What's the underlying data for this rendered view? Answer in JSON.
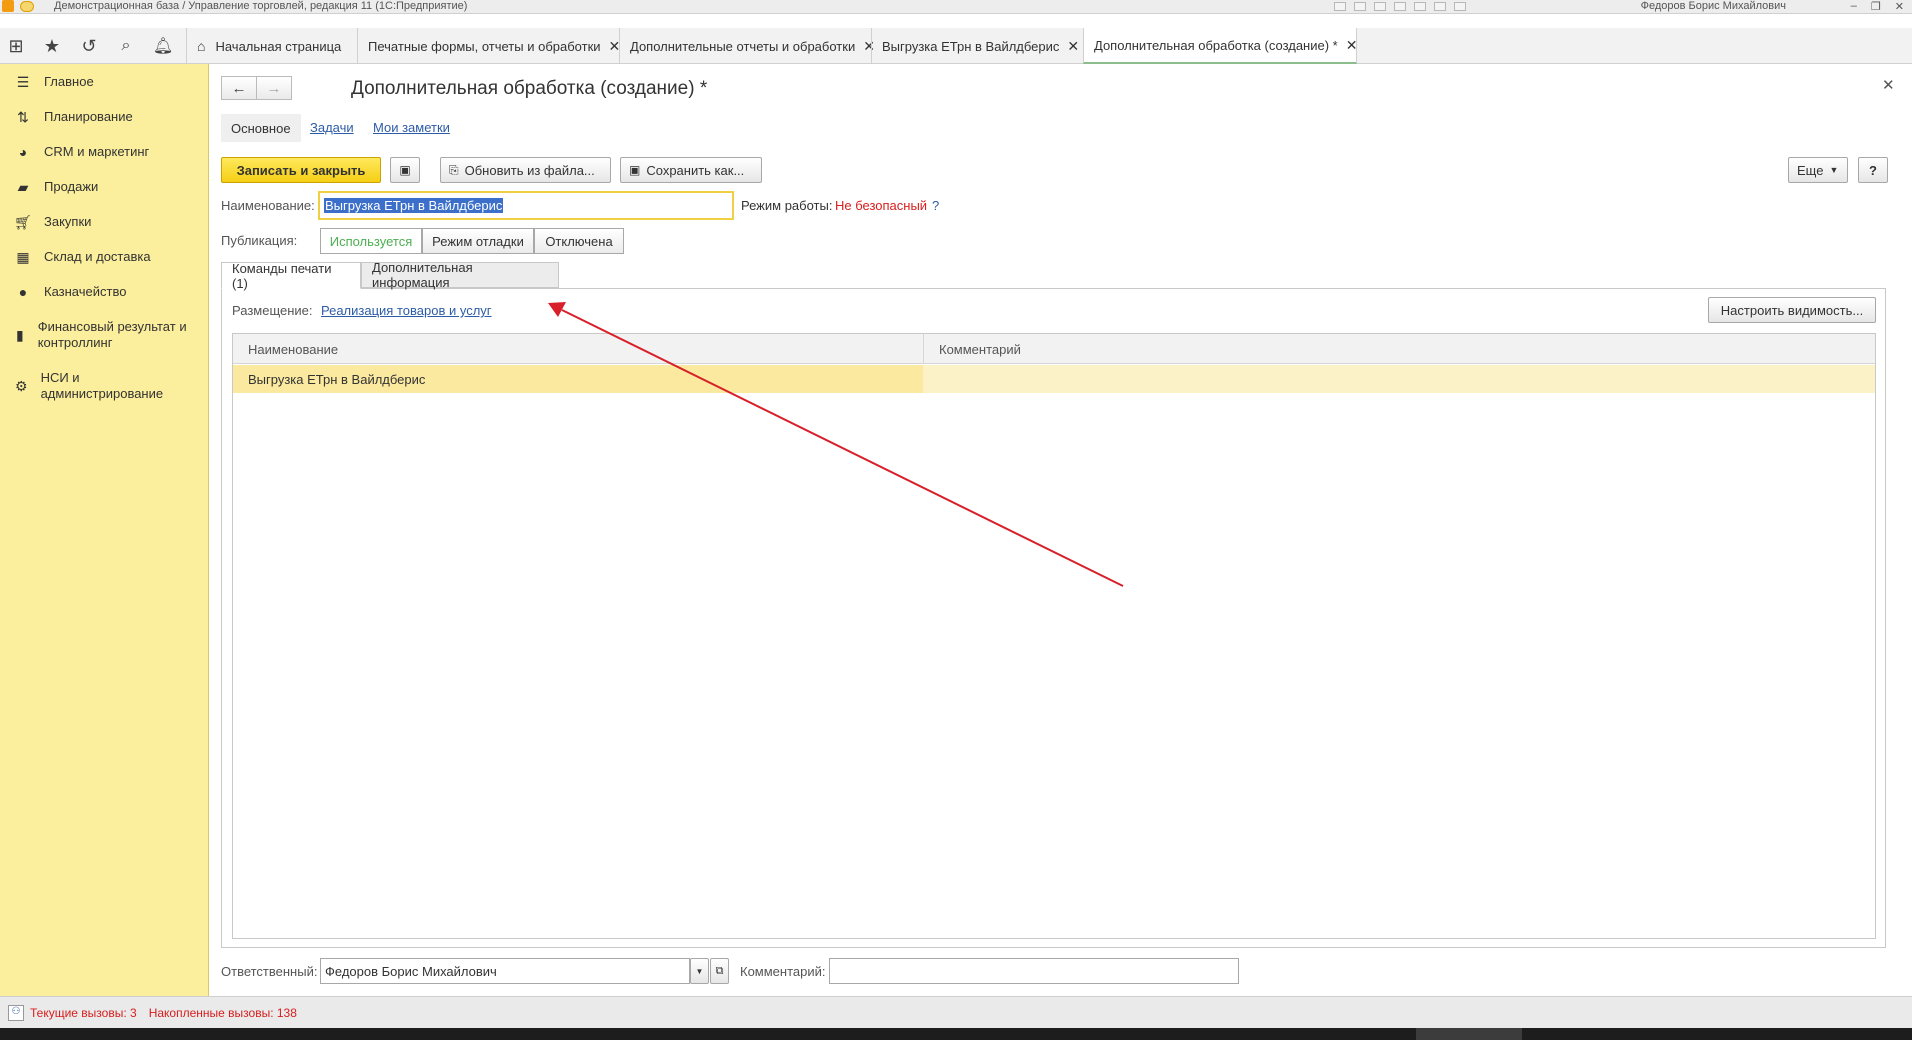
{
  "window": {
    "title": "Демонстрационная база / Управление торговлей, редакция 11  (1С:Предприятие)",
    "user": "Федоров Борис Михайлович"
  },
  "tabs": [
    {
      "label": "Начальная страница",
      "closable": false,
      "active": false
    },
    {
      "label": "Печатные формы, отчеты и обработки",
      "closable": true,
      "active": false
    },
    {
      "label": "Дополнительные отчеты и обработки",
      "closable": true,
      "active": false
    },
    {
      "label": "Выгрузка ЕТрн в Вайлдберис",
      "closable": true,
      "active": false
    },
    {
      "label": "Дополнительная обработка (создание) *",
      "closable": true,
      "active": true
    }
  ],
  "sidebar": {
    "items": [
      {
        "label": "Главное",
        "icon": "menu-icon"
      },
      {
        "label": "Планирование",
        "icon": "planning-icon"
      },
      {
        "label": "CRM и маркетинг",
        "icon": "pie-chart-icon"
      },
      {
        "label": "Продажи",
        "icon": "bag-icon"
      },
      {
        "label": "Закупки",
        "icon": "cart-icon"
      },
      {
        "label": "Склад и доставка",
        "icon": "warehouse-icon"
      },
      {
        "label": "Казначейство",
        "icon": "ruble-icon"
      },
      {
        "label": "Финансовый результат и контроллинг",
        "icon": "bar-chart-icon"
      },
      {
        "label": "НСИ и администрирование",
        "icon": "gear-icon"
      }
    ]
  },
  "form": {
    "title": "Дополнительная обработка (создание) *",
    "subnav": [
      "Основное",
      "Задачи",
      "Мои заметки"
    ],
    "toolbar": {
      "save_close": "Записать и закрыть",
      "update_from_file": "Обновить из файла...",
      "save_as": "Сохранить как...",
      "more": "Еще",
      "help": "?"
    },
    "name_label": "Наименование:",
    "name_value": "Выгрузка ЕТрн в Вайлдберис",
    "mode_label": "Режим работы:",
    "mode_value": "Не безопасный",
    "mode_help": "?",
    "publication_label": "Публикация:",
    "publication_options": [
      "Используется",
      "Режим отладки",
      "Отключена"
    ],
    "publication_selected": "Используется",
    "tabs": [
      "Команды печати (1)",
      "Дополнительная информация"
    ],
    "placement_label": "Размещение:",
    "placement_link": "Реализация товаров и услуг",
    "visibility_button": "Настроить видимость...",
    "table": {
      "columns": [
        "Наименование",
        "Комментарий"
      ],
      "rows": [
        {
          "name": "Выгрузка ЕТрн в Вайлдберис",
          "comment": ""
        }
      ]
    },
    "responsible_label": "Ответственный:",
    "responsible_value": "Федоров Борис Михайлович",
    "comment_label": "Комментарий:",
    "comment_value": ""
  },
  "status": {
    "current_calls": "Текущие вызовы: 3",
    "accumulated_calls": "Накопленные вызовы: 138"
  },
  "colors": {
    "sidebar_bg": "#fbee9c",
    "primary_button": "#f5d51c",
    "link": "#2d5ca6",
    "danger_text": "#d81e1e",
    "arrow": "#d8202a"
  }
}
